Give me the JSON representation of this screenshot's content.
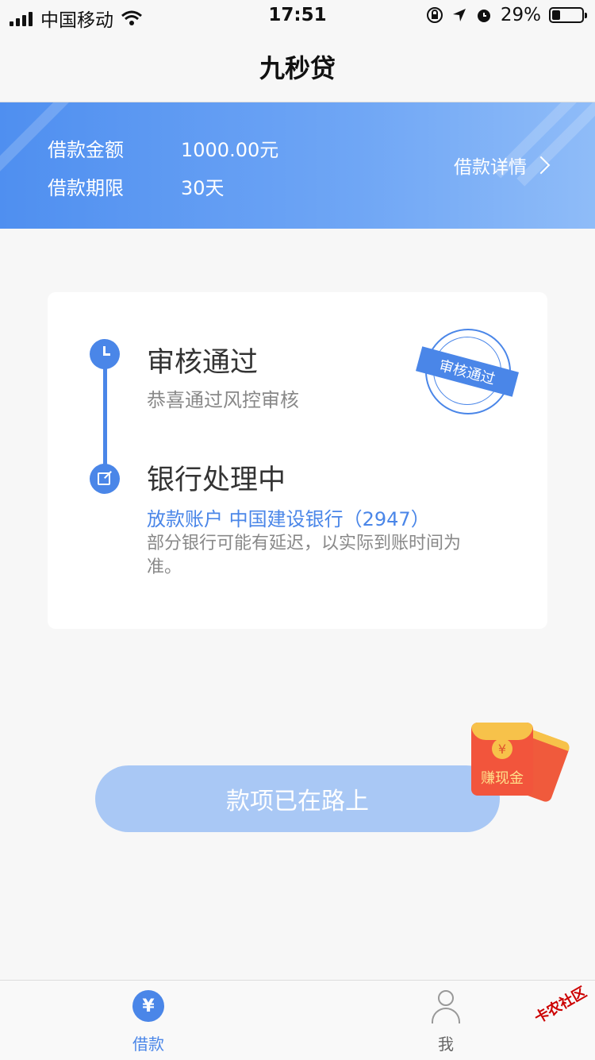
{
  "status_bar": {
    "carrier": "中国移动",
    "time": "17:51",
    "battery_percent": "29%",
    "battery_level": 0.29
  },
  "nav": {
    "title": "九秒贷"
  },
  "banner": {
    "amount_label": "借款金额",
    "amount_value": "1000.00元",
    "term_label": "借款期限",
    "term_value": "30天",
    "detail_link": "借款详情"
  },
  "steps": [
    {
      "icon": "clock-icon",
      "title": "审核通过",
      "subtitle": "恭喜通过风控审核"
    },
    {
      "icon": "edit-icon",
      "title": "银行处理中",
      "bank": "放款账户 中国建设银行（2947）",
      "note": "部分银行可能有延迟，以实际到账时间为准。"
    }
  ],
  "stamp": {
    "text": "审核通过"
  },
  "button": {
    "label": "款项已在路上"
  },
  "red_packet": {
    "coin": "¥",
    "label": "赚现金"
  },
  "tabs": [
    {
      "icon": "yen-icon",
      "icon_text": "¥",
      "label": "借款",
      "active": true
    },
    {
      "icon": "person-icon",
      "label": "我",
      "active": false
    }
  ],
  "watermark": {
    "text": "卡农社区"
  },
  "colors": {
    "accent": "#4a86e8",
    "button_disabled": "#a9c8f5",
    "red_packet": "#f2553c"
  }
}
